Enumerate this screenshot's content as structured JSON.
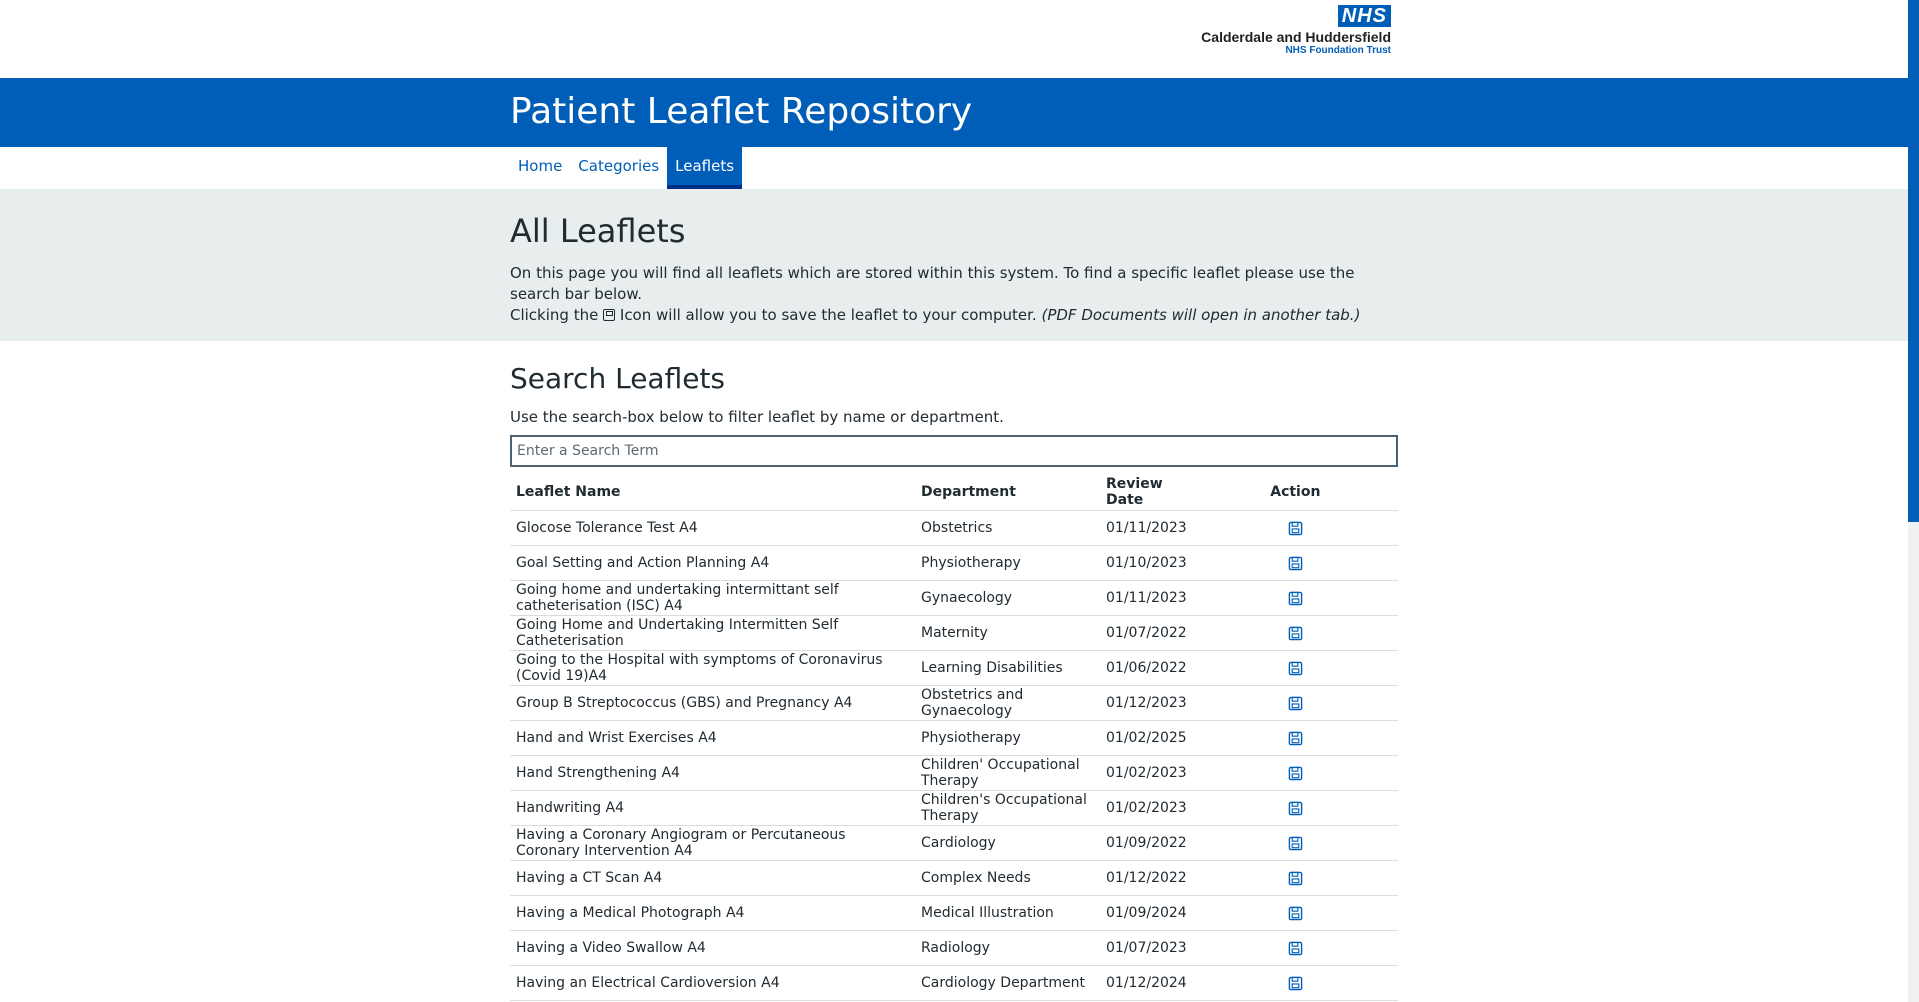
{
  "logo": {
    "nhs": "NHS",
    "trust": "Calderdale and Huddersfield",
    "subtitle": "NHS Foundation Trust"
  },
  "header": {
    "title": "Patient Leaflet Repository"
  },
  "nav": {
    "items": [
      {
        "label": "Home",
        "active": false
      },
      {
        "label": "Categories",
        "active": false
      },
      {
        "label": "Leaflets",
        "active": true
      }
    ]
  },
  "intro": {
    "title": "All Leaflets",
    "text1": "On this page you will find all leaflets which are stored within this system. To find a specific leaflet please use the search bar below.",
    "text2a": "Clicking the",
    "text2b": "Icon will allow you to save the leaflet to your computer.",
    "text2c": "(PDF Documents will open in another tab.)"
  },
  "search": {
    "title": "Search Leaflets",
    "description": "Use the search-box below to filter leaflet by name or department.",
    "placeholder": "Enter a Search Term",
    "value": ""
  },
  "table": {
    "headers": [
      "Leaflet Name",
      "Department",
      "Review Date",
      "Action"
    ],
    "rows": [
      [
        "Glocose Tolerance Test A4",
        "Obstetrics",
        "01/11/2023"
      ],
      [
        "Goal Setting and Action Planning A4",
        "Physiotherapy",
        "01/10/2023"
      ],
      [
        "Going home and undertaking intermittant self catheterisation (ISC) A4",
        "Gynaecology",
        "01/11/2023"
      ],
      [
        "Going Home and Undertaking Intermitten Self Catheterisation",
        "Maternity",
        "01/07/2022"
      ],
      [
        "Going to the Hospital with symptoms of Coronavirus (Covid 19)A4",
        "Learning Disabilities",
        "01/06/2022"
      ],
      [
        "Group B Streptococcus (GBS) and Pregnancy A4",
        "Obstetrics and Gynaecology",
        "01/12/2023"
      ],
      [
        "Hand and Wrist Exercises A4",
        "Physiotherapy",
        "01/02/2025"
      ],
      [
        "Hand Strengthening A4",
        "Children' Occupational Therapy",
        "01/02/2023"
      ],
      [
        "Handwriting A4",
        "Children's Occupational Therapy",
        "01/02/2023"
      ],
      [
        "Having a Coronary Angiogram or Percutaneous Coronary Intervention A4",
        "Cardiology",
        "01/09/2022"
      ],
      [
        "Having a CT Scan A4",
        "Complex Needs",
        "01/12/2022"
      ],
      [
        "Having a Medical Photograph A4",
        "Medical Illustration",
        "01/09/2024"
      ],
      [
        "Having a Video Swallow A4",
        "Radiology",
        "01/07/2023"
      ],
      [
        "Having an Electrical Cardioversion A4",
        "Cardiology Department",
        "01/12/2024"
      ]
    ]
  },
  "colors": {
    "brand": "#005eb8",
    "band": "#e8edee",
    "text": "#212b32"
  },
  "icons": {
    "action": "save-icon"
  }
}
